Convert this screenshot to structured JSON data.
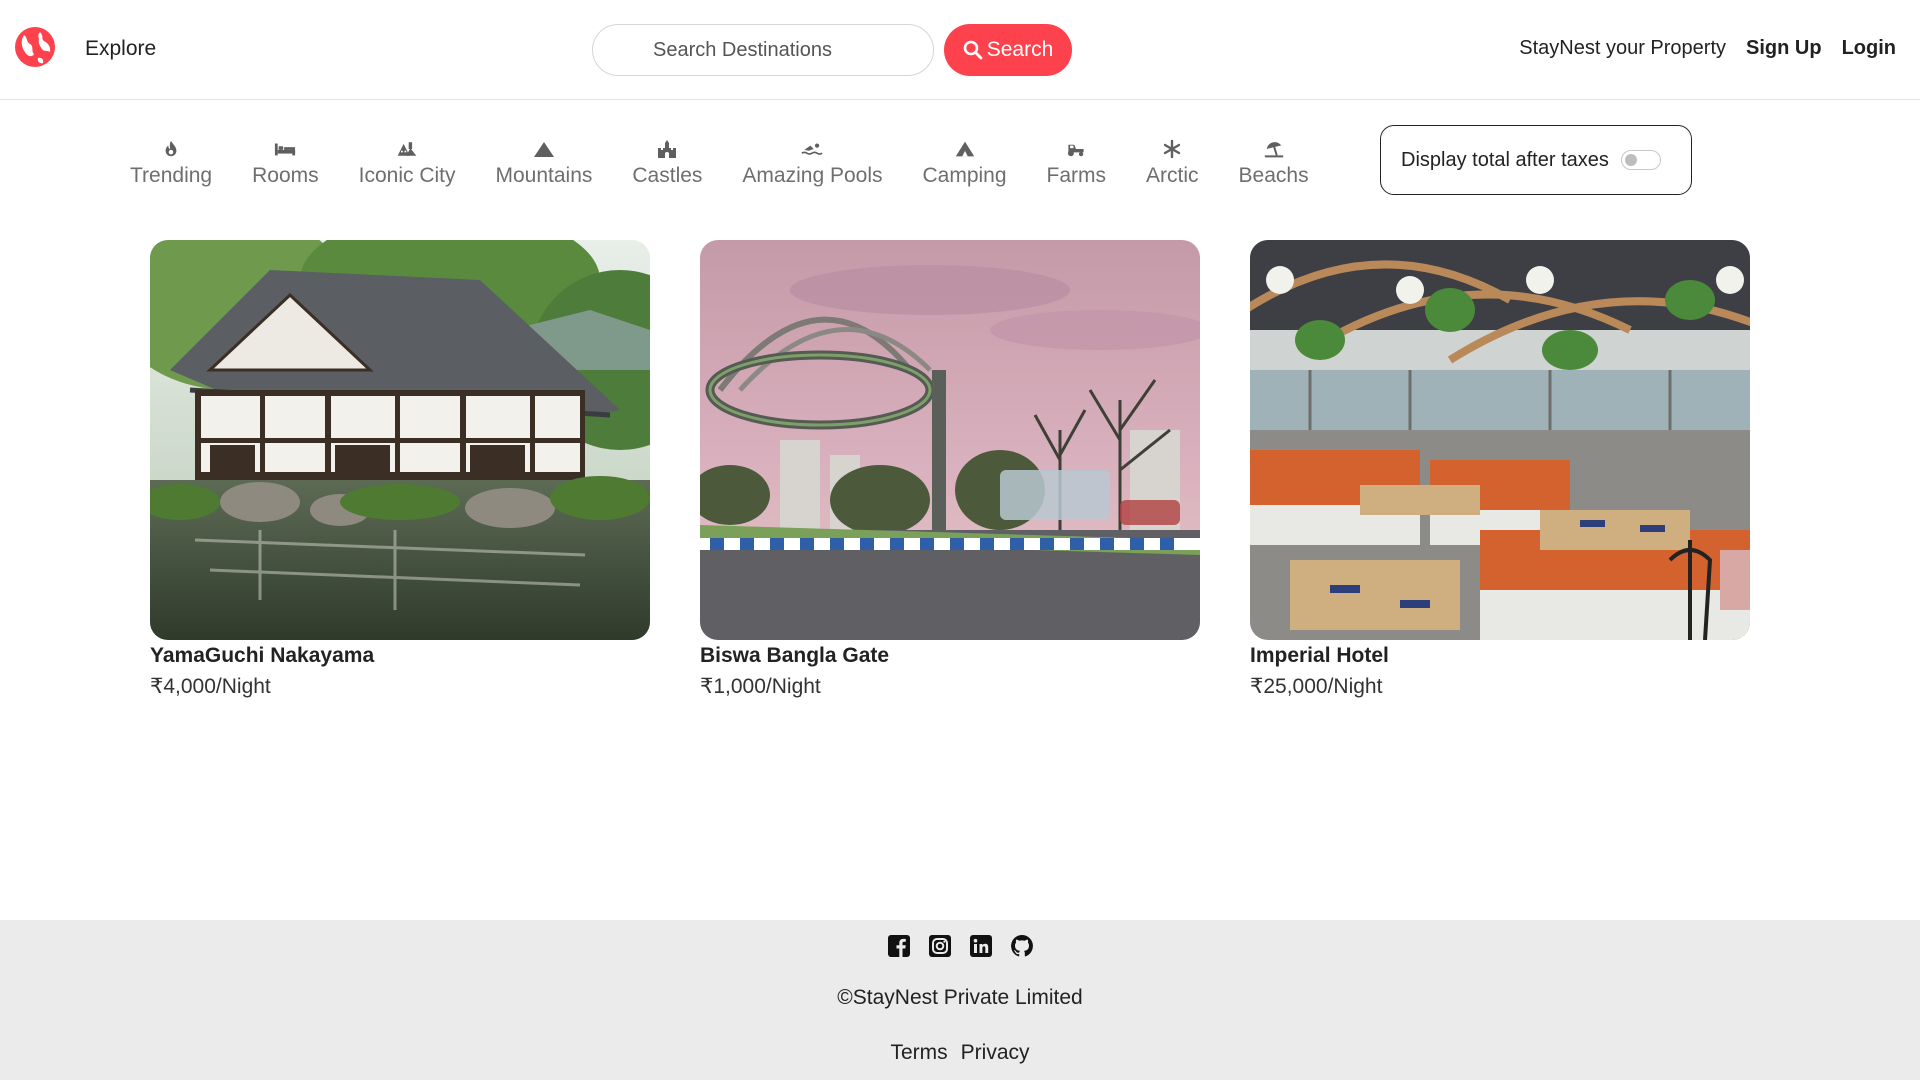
{
  "nav": {
    "explore_label": "Explore",
    "search_placeholder": "Search Destinations",
    "search_button_label": "Search",
    "list_property_label": "StayNest your Property",
    "signup_label": "Sign Up",
    "login_label": "Login",
    "accent_color": "#fe424d"
  },
  "filters": [
    {
      "label": "Trending",
      "icon": "fire-icon"
    },
    {
      "label": "Rooms",
      "icon": "bed-icon"
    },
    {
      "label": "Iconic City",
      "icon": "city-icon"
    },
    {
      "label": "Mountains",
      "icon": "mountain-icon"
    },
    {
      "label": "Castles",
      "icon": "castle-icon"
    },
    {
      "label": "Amazing Pools",
      "icon": "swimmer-icon"
    },
    {
      "label": "Camping",
      "icon": "tent-icon"
    },
    {
      "label": "Farms",
      "icon": "tractor-icon"
    },
    {
      "label": "Arctic",
      "icon": "snowflake-icon"
    },
    {
      "label": "Beachs",
      "icon": "umbrella-beach-icon"
    }
  ],
  "tax_toggle": {
    "label": "Display total after taxes",
    "on": false
  },
  "listings": [
    {
      "title": "YamaGuchi Nakayama",
      "price": "₹4,000/Night"
    },
    {
      "title": "Biswa Bangla Gate",
      "price": "₹1,000/Night"
    },
    {
      "title": "Imperial Hotel",
      "price": "₹25,000/Night"
    }
  ],
  "footer": {
    "socials": [
      "facebook-icon",
      "instagram-icon",
      "linkedin-icon",
      "github-icon"
    ],
    "copyright": "©StayNest Private Limited",
    "terms_label": "Terms",
    "privacy_label": "Privacy"
  }
}
